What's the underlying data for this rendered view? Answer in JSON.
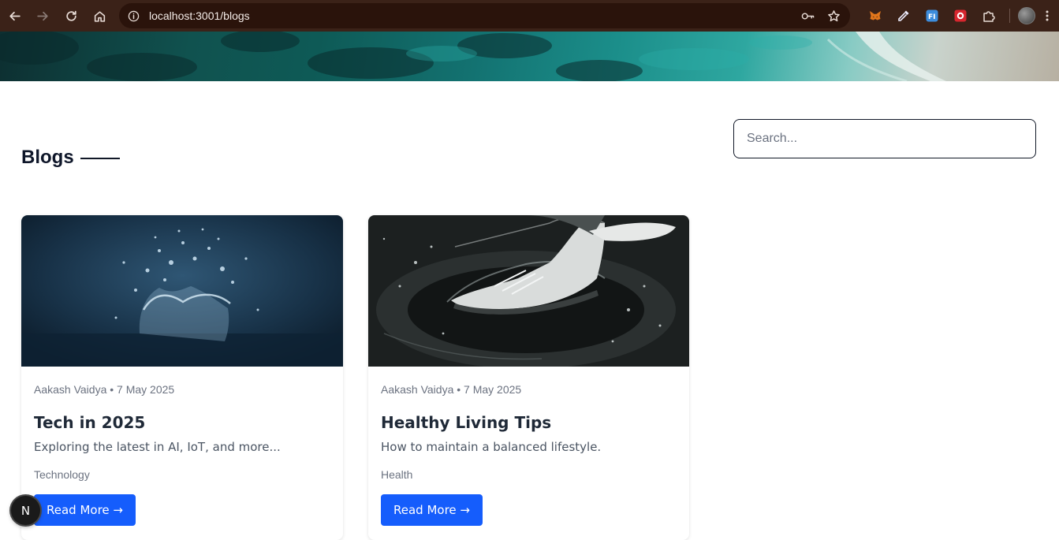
{
  "browser": {
    "url": "localhost:3001/blogs"
  },
  "page": {
    "heading": "Blogs",
    "search": {
      "placeholder": "Search..."
    }
  },
  "posts": [
    {
      "author_date": "Aakash Vaidya • 7 May 2025",
      "title": "Tech in 2025",
      "description": "Exploring the latest in AI, IoT, and more...",
      "category": "Technology",
      "button_label": "Read More →"
    },
    {
      "author_date": "Aakash Vaidya • 7 May 2025",
      "title": "Healthy Living Tips",
      "description": "How to maintain a balanced lifestyle.",
      "category": "Health",
      "button_label": "Read More →"
    }
  ],
  "devtools": {
    "badge": "N"
  },
  "colors": {
    "primary_button": "#155dfc",
    "browser_chrome": "#3b2218"
  },
  "icons": [
    "back-icon",
    "forward-icon",
    "reload-icon",
    "home-icon",
    "site-info-icon",
    "password-key-icon",
    "bookmark-star-icon",
    "metamask-extension-icon",
    "color-picker-extension-icon",
    "fi-extension-icon",
    "red-extension-icon",
    "extensions-puzzle-icon",
    "profile-avatar"
  ]
}
